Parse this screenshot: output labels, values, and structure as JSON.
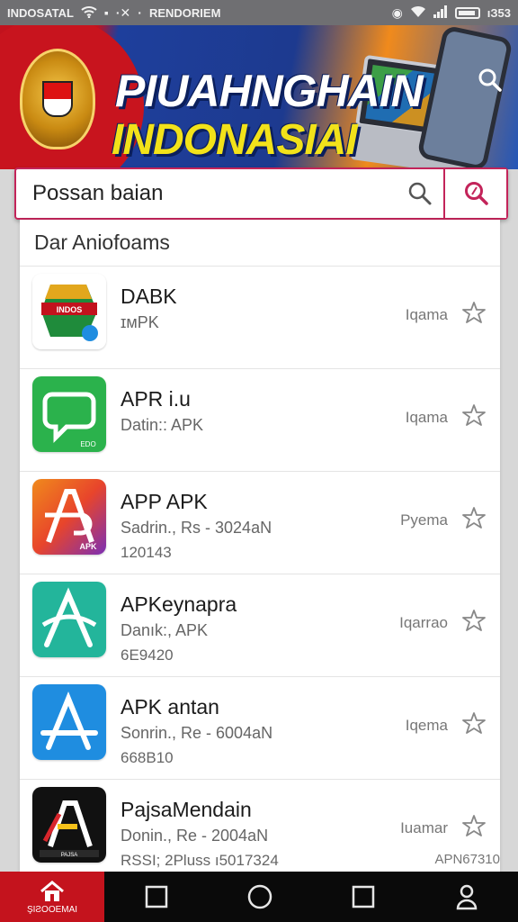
{
  "status_bar": {
    "carrier": "INDOSATAL",
    "network_name": "RENDORIEM",
    "time": "ıЗ53",
    "icons": [
      "wifi-icon",
      "notification-icon",
      "vpn-icon",
      "signal-icon",
      "battery-icon"
    ]
  },
  "banner": {
    "title_line1": "PIUAHNGHAIN",
    "title_line2": "INDONASIAI",
    "colors": {
      "red": "#c2121d",
      "blue": "#1d3a8f",
      "orange": "#f08a1c",
      "yellow": "#f2e21a"
    }
  },
  "search": {
    "placeholder": "Possan baian"
  },
  "list": {
    "header": "Dar Aniofoams",
    "items": [
      {
        "name": "DABK",
        "sub": "ɪᴍPK",
        "sub2": "",
        "meta": "Iqama",
        "extra": "",
        "icon": "dabk-app-icon",
        "icon_colors": [
          "#1f8b3b",
          "#d8262c"
        ]
      },
      {
        "name": "APR i.u",
        "sub": "Datin:: APK",
        "sub2": "",
        "meta": "Iqama",
        "extra": "",
        "icon": "chat-app-icon",
        "icon_colors": [
          "#2bb24c"
        ]
      },
      {
        "name": "APP APK",
        "sub": "Sadrin., Rs - 3024aN",
        "sub2": "120143",
        "meta": "Pyema",
        "extra": "",
        "icon": "app-apk-icon",
        "icon_colors": [
          "#e8452b",
          "#7b2fb5"
        ]
      },
      {
        "name": "APKeynapra",
        "sub": "Danık:, APK",
        "sub2": "6E9420",
        "meta": "Iqarrao",
        "extra": "",
        "icon": "apk-store-icon",
        "icon_colors": [
          "#23b59b"
        ]
      },
      {
        "name": "APK antan",
        "sub": "Sonrin., Re - 6004aN",
        "sub2": "668B10",
        "meta": "Iqema",
        "extra": "",
        "icon": "apk-antan-icon",
        "icon_colors": [
          "#1f8de0"
        ]
      },
      {
        "name": "PajsaMendain",
        "sub": "Donin., Re - 2004aN",
        "sub2": "RSSI; 2Pluss    ı5017324",
        "meta": "Iuamar",
        "extra": "APN67310",
        "icon": "pajsa-app-icon",
        "icon_colors": [
          "#111111",
          "#f5c11a"
        ]
      }
    ]
  },
  "bottom_nav": {
    "home_label": "ŞIƧOOEMAI",
    "items": [
      "home-icon",
      "square-nav-icon",
      "circle-nav-icon",
      "recents-icon",
      "profile-icon"
    ]
  }
}
